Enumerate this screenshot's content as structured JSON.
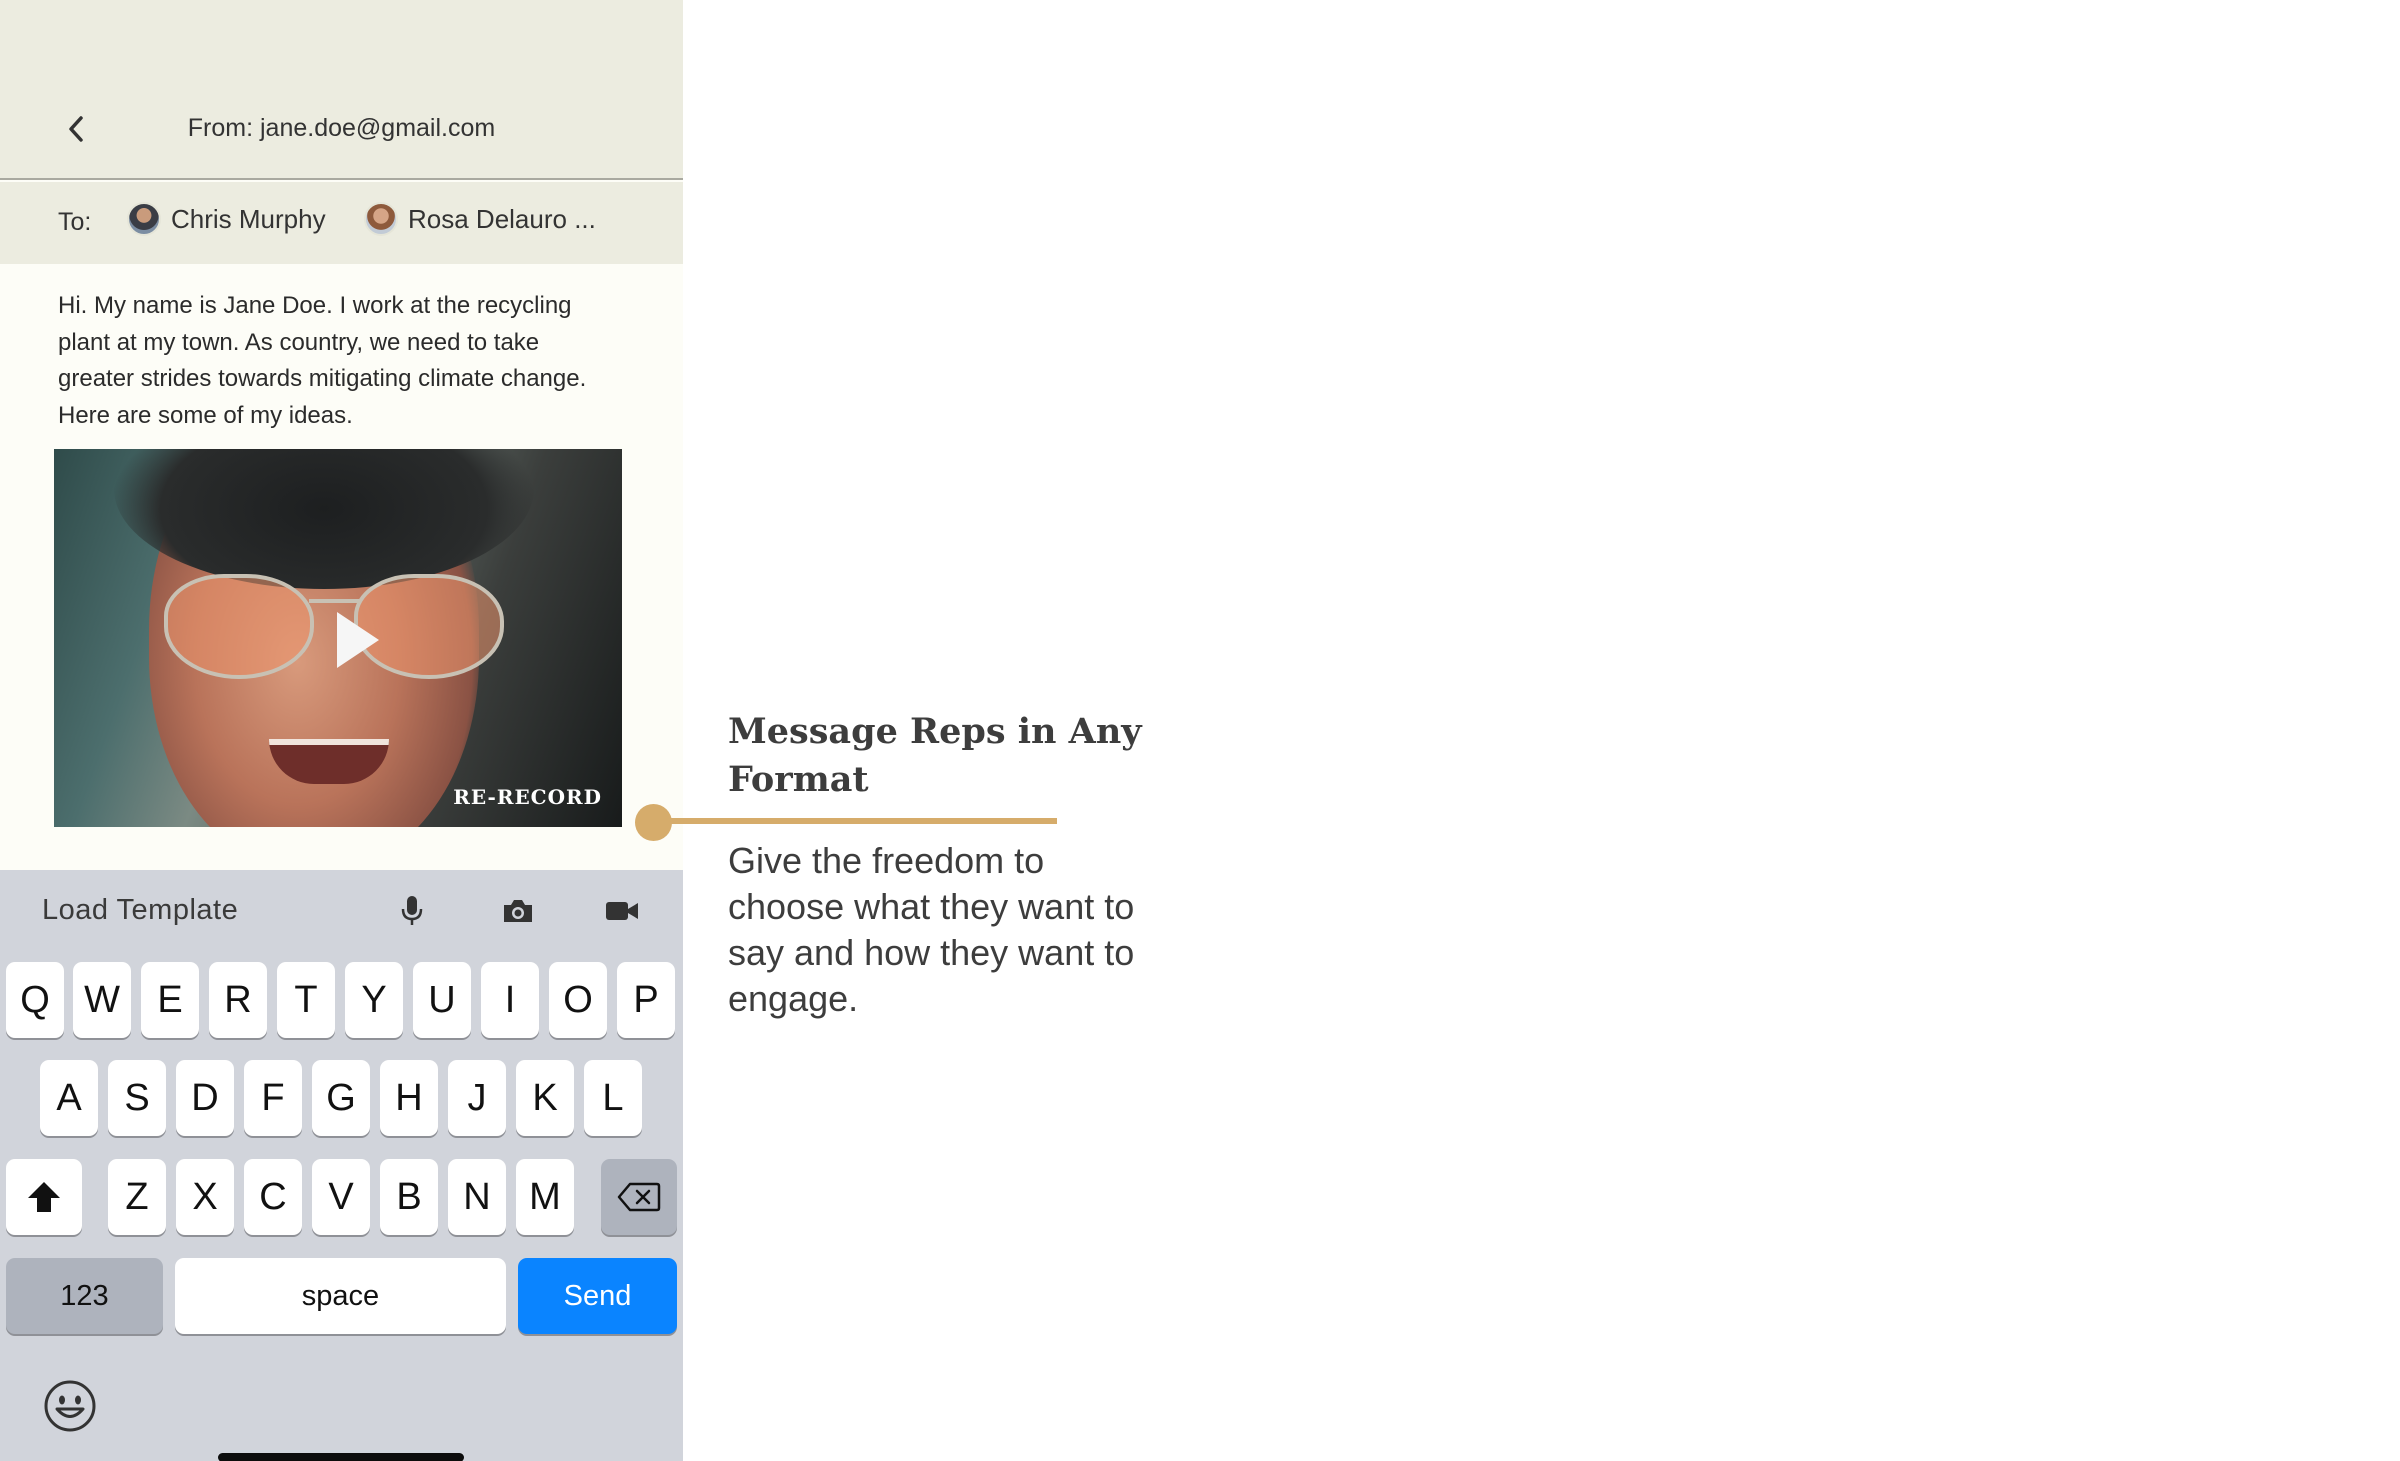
{
  "header": {
    "from": "From: jane.doe@gmail.com"
  },
  "recipients": {
    "label": "To:",
    "items": [
      {
        "name": "Chris Murphy"
      },
      {
        "name": "Rosa Delauro ..."
      }
    ]
  },
  "message": {
    "body": "Hi. My name is Jane Doe. I work at the recycling plant at my town. As country, we need to take greater strides towards mitigating climate change. Here are some of my ideas."
  },
  "video": {
    "action_label": "RE-RECORD",
    "play_icon": "play-icon"
  },
  "toolbar": {
    "load_template": "Load Template",
    "icons": [
      "microphone-icon",
      "camera-icon",
      "video-camera-icon"
    ]
  },
  "keyboard": {
    "row1": [
      "Q",
      "W",
      "E",
      "R",
      "T",
      "Y",
      "U",
      "I",
      "O",
      "P"
    ],
    "row2": [
      "A",
      "S",
      "D",
      "F",
      "G",
      "H",
      "J",
      "K",
      "L"
    ],
    "row3": [
      "Z",
      "X",
      "C",
      "V",
      "B",
      "N",
      "M"
    ],
    "numbers_label": "123",
    "space_label": "space",
    "send_label": "Send",
    "send_color": "#0a84ff"
  },
  "feature": {
    "title": "Message Reps in Any Format",
    "description": "Give the freedom to choose what they want to say and how they want to engage.",
    "accent_color": "#d6ac6b"
  }
}
